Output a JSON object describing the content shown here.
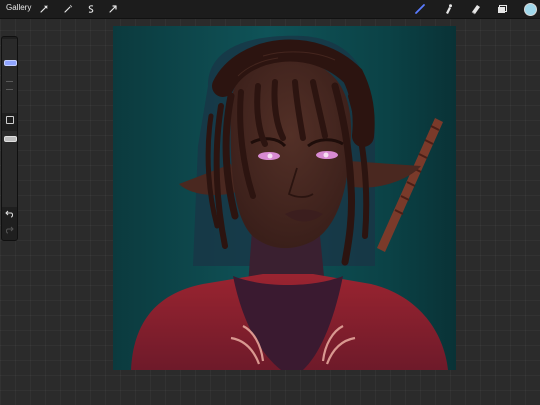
{
  "topbar": {
    "gallery_label": "Gallery",
    "left_tools": [
      "wrench-icon",
      "magic-wand-icon",
      "selection-icon",
      "transform-icon"
    ],
    "right_tools": [
      "brush-icon",
      "smudge-icon",
      "eraser-icon",
      "layers-icon"
    ],
    "current_color": "#9fd7ea",
    "brush_accent": "#5a7cff"
  },
  "sidebar": {
    "brush_size_accent": "#8fa4ff",
    "tools": [
      "brush-size-slider",
      "modify-button",
      "opacity-slider",
      "undo-icon",
      "redo-icon"
    ]
  },
  "canvas": {
    "colors": {
      "background": "#0f4b4f",
      "skin": "#4a2820",
      "hair": "#2c1410",
      "eyes": "#d88ad2",
      "clothing": "#8e1f2c",
      "embroidery": "#d99890"
    }
  }
}
